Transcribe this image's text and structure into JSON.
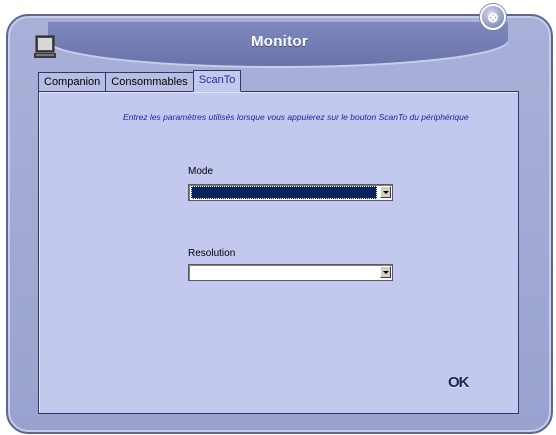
{
  "window": {
    "title": "Monitor",
    "close_glyph": "⊗",
    "app_icon": "monitor-icon"
  },
  "tabs": [
    {
      "label": "Companion",
      "active": false
    },
    {
      "label": "Consommables",
      "active": false
    },
    {
      "label": "ScanTo",
      "active": true
    }
  ],
  "scanto": {
    "description": "Entrez les paramètres utilisés lorsque vous appuierez sur le bouton ScanTo du périphérique",
    "mode_label": "Mode",
    "mode_value": "",
    "resolution_label": "Resolution",
    "resolution_value": ""
  },
  "actions": {
    "ok_label": "OK"
  },
  "colors": {
    "window_bg": "#a9b0d8",
    "panel_bg": "#c3c8ee",
    "active_tab_text": "#27319a",
    "description_text": "#1c2896",
    "selected_option_bg": "#0a2460"
  }
}
